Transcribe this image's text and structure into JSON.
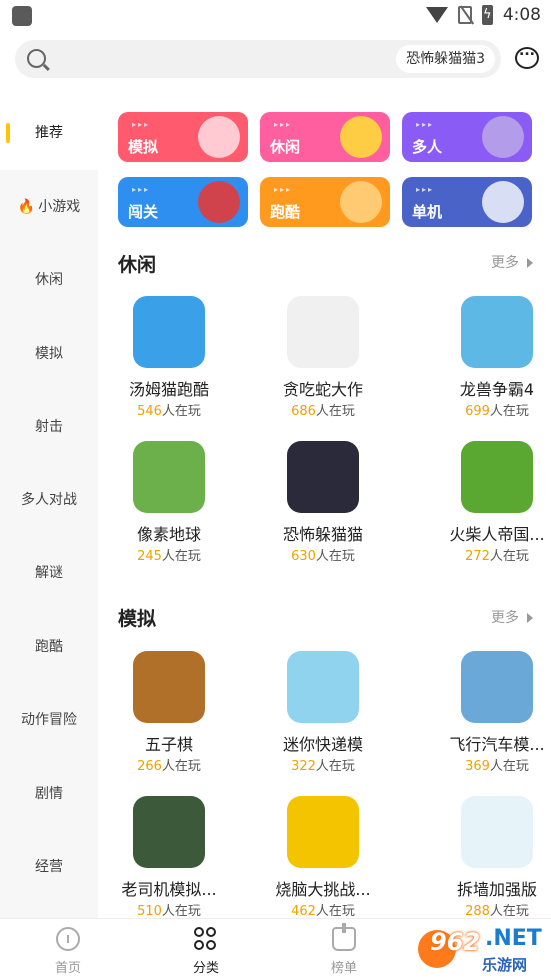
{
  "status_bar": {
    "time": "4:08"
  },
  "search": {
    "hint": "恐怖躲猫猫3"
  },
  "sidebar": {
    "items": [
      {
        "label": "推荐",
        "active": true
      },
      {
        "label": "小游戏",
        "icon": "fire-icon"
      },
      {
        "label": "休闲"
      },
      {
        "label": "模拟"
      },
      {
        "label": "射击"
      },
      {
        "label": "多人对战"
      },
      {
        "label": "解谜"
      },
      {
        "label": "跑酷"
      },
      {
        "label": "动作冒险"
      },
      {
        "label": "剧情"
      },
      {
        "label": "经营"
      }
    ]
  },
  "categories": [
    {
      "label": "模拟",
      "color": "#ff5a6e",
      "icon": "puzzle-icon"
    },
    {
      "label": "休闲",
      "color": "#ff5f9e",
      "icon": "duck-icon"
    },
    {
      "label": "多人",
      "color": "#8a5cf5",
      "icon": "helmet-icon"
    },
    {
      "label": "闯关",
      "color": "#2f8ff0",
      "icon": "boxing-glove-icon"
    },
    {
      "label": "跑酷",
      "color": "#ff9a1f",
      "icon": "skater-icon"
    },
    {
      "label": "单机",
      "color": "#4a63c9",
      "icon": "gamepad-icon"
    }
  ],
  "sections": [
    {
      "title": "休闲",
      "more": "更多",
      "games": [
        {
          "name": "汤姆猫跑酷",
          "count": "546",
          "suffix": "人在玩",
          "color": "#3aa0e8"
        },
        {
          "name": "贪吃蛇大作",
          "count": "686",
          "suffix": "人在玩",
          "color": "#f0f0f0"
        },
        {
          "name": "龙兽争霸4",
          "count": "699",
          "suffix": "人在玩",
          "color": "#5db8e6"
        },
        {
          "name": "像素地球",
          "count": "245",
          "suffix": "人在玩",
          "color": "#6bb04a"
        },
        {
          "name": "恐怖躲猫猫",
          "count": "630",
          "suffix": "人在玩",
          "color": "#2a2a3a"
        },
        {
          "name": "火柴人帝国...",
          "count": "272",
          "suffix": "人在玩",
          "color": "#5aa832"
        }
      ]
    },
    {
      "title": "模拟",
      "more": "更多",
      "games": [
        {
          "name": "五子棋",
          "count": "266",
          "suffix": "人在玩",
          "color": "#b0702a"
        },
        {
          "name": "迷你快递模",
          "count": "322",
          "suffix": "人在玩",
          "color": "#8fd3ee"
        },
        {
          "name": "飞行汽车模...",
          "count": "369",
          "suffix": "人在玩",
          "color": "#6aa8d8"
        },
        {
          "name": "老司机模拟...",
          "count": "510",
          "suffix": "人在玩",
          "color": "#3c5a3a"
        },
        {
          "name": "烧脑大挑战...",
          "count": "462",
          "suffix": "人在玩",
          "color": "#f4c400"
        },
        {
          "name": "拆墙加强版",
          "count": "288",
          "suffix": "人在玩",
          "color": "#e6f3f8"
        }
      ]
    }
  ],
  "bottom_nav": {
    "items": [
      {
        "label": "首页",
        "icon": "home-icon"
      },
      {
        "label": "分类",
        "icon": "category-icon",
        "active": true
      },
      {
        "label": "榜单",
        "icon": "ranking-icon"
      }
    ]
  },
  "watermark": {
    "number": "962",
    "dot_net": ".NET",
    "subtitle": "乐游网"
  }
}
